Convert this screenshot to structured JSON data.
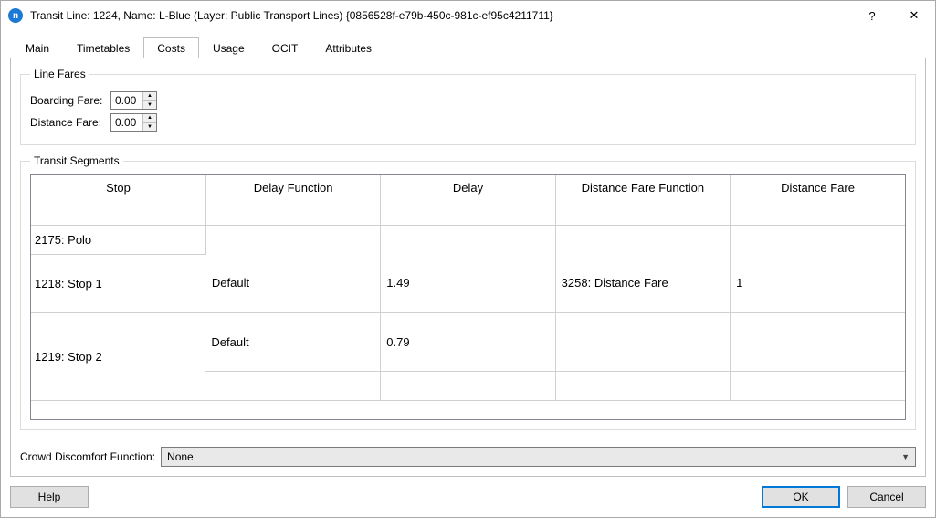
{
  "titlebar": {
    "icon_letter": "n",
    "title": "Transit Line: 1224, Name: L-Blue (Layer: Public Transport Lines) {0856528f-e79b-450c-981c-ef95c4211711}",
    "help_glyph": "?",
    "close_glyph": "✕"
  },
  "tabs": [
    {
      "label": "Main",
      "active": false
    },
    {
      "label": "Timetables",
      "active": false
    },
    {
      "label": "Costs",
      "active": true
    },
    {
      "label": "Usage",
      "active": false
    },
    {
      "label": "OCIT",
      "active": false
    },
    {
      "label": "Attributes",
      "active": false
    }
  ],
  "line_fares": {
    "legend": "Line Fares",
    "boarding_label": "Boarding Fare:",
    "boarding_value": "0.00",
    "distance_label": "Distance Fare:",
    "distance_value": "0.00"
  },
  "segments": {
    "legend": "Transit Segments",
    "headers": {
      "stop": "Stop",
      "delay_function": "Delay Function",
      "delay": "Delay",
      "distance_fare_function": "Distance Fare Function",
      "distance_fare": "Distance Fare"
    },
    "stops": [
      "2175: Polo",
      "1218: Stop 1",
      "1219: Stop 2"
    ],
    "seg_rows": [
      {
        "delay_function": "Default",
        "delay": "1.49",
        "distance_fare_function": "3258: Distance Fare",
        "distance_fare": "1"
      },
      {
        "delay_function": "Default",
        "delay": "0.79",
        "distance_fare_function": "",
        "distance_fare": ""
      },
      {
        "delay_function": "",
        "delay": "",
        "distance_fare_function": "",
        "distance_fare": ""
      }
    ]
  },
  "crowd": {
    "label": "Crowd Discomfort Function:",
    "value": "None"
  },
  "buttons": {
    "help": "Help",
    "ok": "OK",
    "cancel": "Cancel"
  }
}
